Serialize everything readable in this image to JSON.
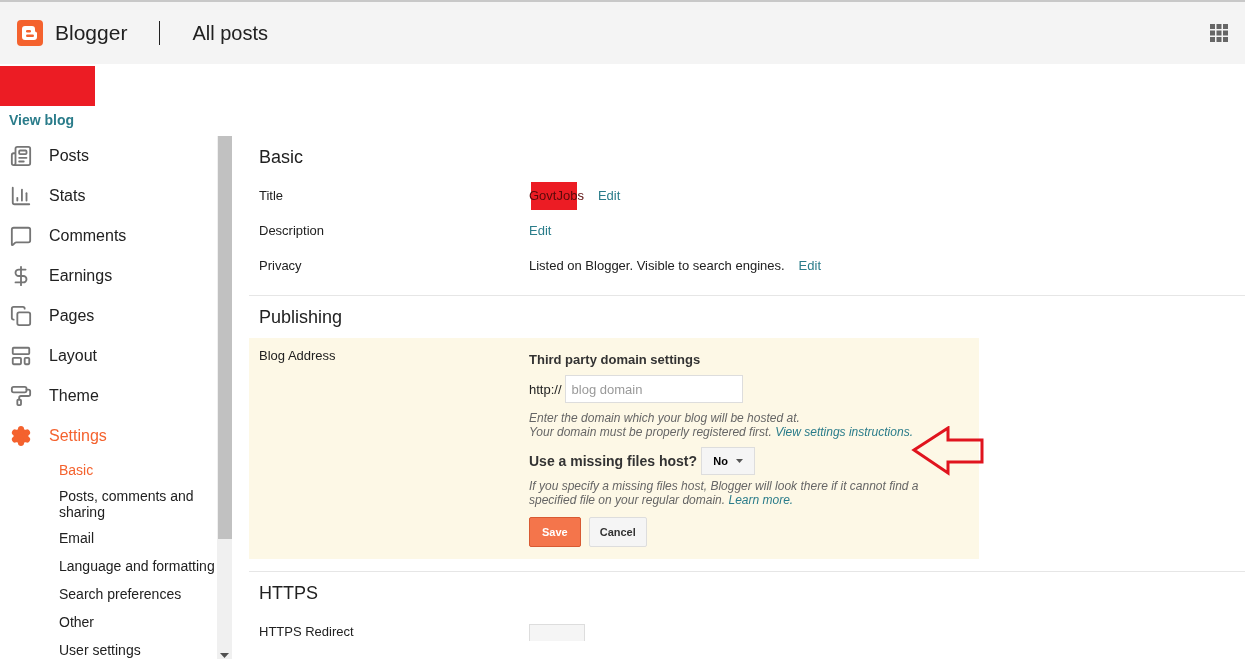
{
  "header": {
    "brand": "Blogger",
    "page_title": "All posts"
  },
  "blog": {
    "name_hidden": true,
    "view_link": "View blog"
  },
  "sidebar": {
    "items": [
      {
        "label": "Posts",
        "selected": false
      },
      {
        "label": "Stats",
        "selected": false
      },
      {
        "label": "Comments",
        "selected": false
      },
      {
        "label": "Earnings",
        "selected": false
      },
      {
        "label": "Pages",
        "selected": false
      },
      {
        "label": "Layout",
        "selected": false
      },
      {
        "label": "Theme",
        "selected": false
      },
      {
        "label": "Settings",
        "selected": true,
        "children": [
          {
            "label": "Basic",
            "selected": true
          },
          {
            "label": "Posts, comments and sharing",
            "selected": false
          },
          {
            "label": "Email",
            "selected": false
          },
          {
            "label": "Language and formatting",
            "selected": false
          },
          {
            "label": "Search preferences",
            "selected": false
          },
          {
            "label": "Other",
            "selected": false
          },
          {
            "label": "User settings",
            "selected": false
          }
        ]
      }
    ]
  },
  "sections": [
    {
      "title": "Basic",
      "rows": [
        {
          "kind": "text",
          "label": "Title",
          "value": "GovtJobs",
          "redacted": true,
          "link": "Edit"
        },
        {
          "kind": "text",
          "label": "Description",
          "link": "Edit"
        },
        {
          "kind": "text",
          "label": "Privacy",
          "value": "Listed on Blogger. Visible to search engines.",
          "link": "Edit"
        }
      ]
    },
    {
      "title": "Publishing",
      "rows": [
        {
          "kind": "domain_form",
          "label": "Blog Address",
          "heading": "Third party domain settings",
          "prefix": "http://",
          "placeholder": "blog domain",
          "hint": "Enter the domain which your blog will be hosted at.",
          "hint_2": "Your domain must be properly registered first.",
          "hint_link": "View settings instructions.",
          "question": "Use a missing files host?",
          "dropdown": "No",
          "note": "If you specify a missing files host, Blogger will look there if it cannot find a specified file on your regular domain.",
          "note_link": "Learn more.",
          "save": "Save",
          "cancel": "Cancel",
          "annotated": true
        }
      ]
    },
    {
      "title": "HTTPS",
      "rows": [
        {
          "kind": "toggle",
          "label": "HTTPS Redirect"
        }
      ]
    }
  ]
}
